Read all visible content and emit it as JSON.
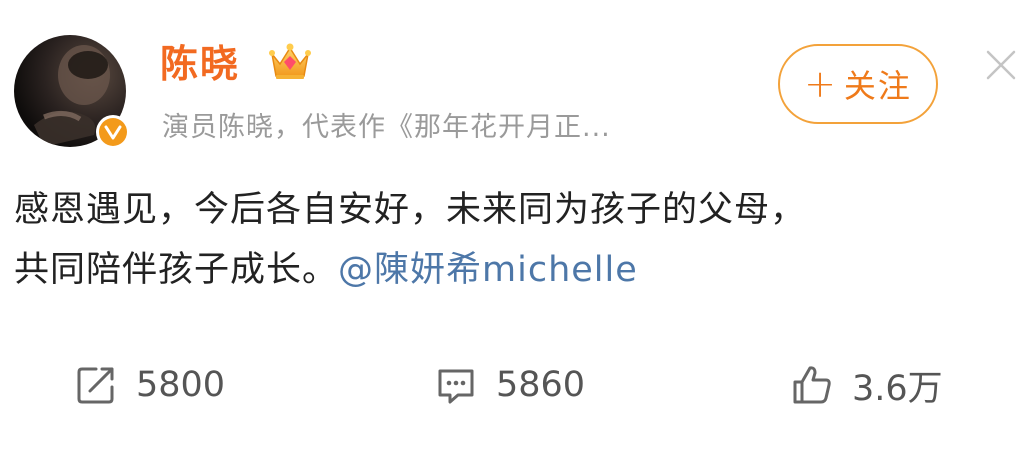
{
  "user": {
    "name": "陈晓",
    "bio": "演员陈晓，代表作《那年花开月正...",
    "verified_color": "#f39a1b",
    "name_color": "#f26a21"
  },
  "follow_button": {
    "plus": "+",
    "label": "关注"
  },
  "post": {
    "line1": "感恩遇见，今后各自安好，未来同为孩子的父母，",
    "line2_text": "共同陪伴孩子成长。",
    "mention": "@陳妍希michelle",
    "mention_color": "#4d77a8"
  },
  "actions": {
    "repost_count": "5800",
    "comment_count": "5860",
    "like_count": "3.6万"
  },
  "icons": [
    "verified-icon",
    "crown-icon",
    "close-icon",
    "repost-icon",
    "comment-icon",
    "like-icon"
  ]
}
